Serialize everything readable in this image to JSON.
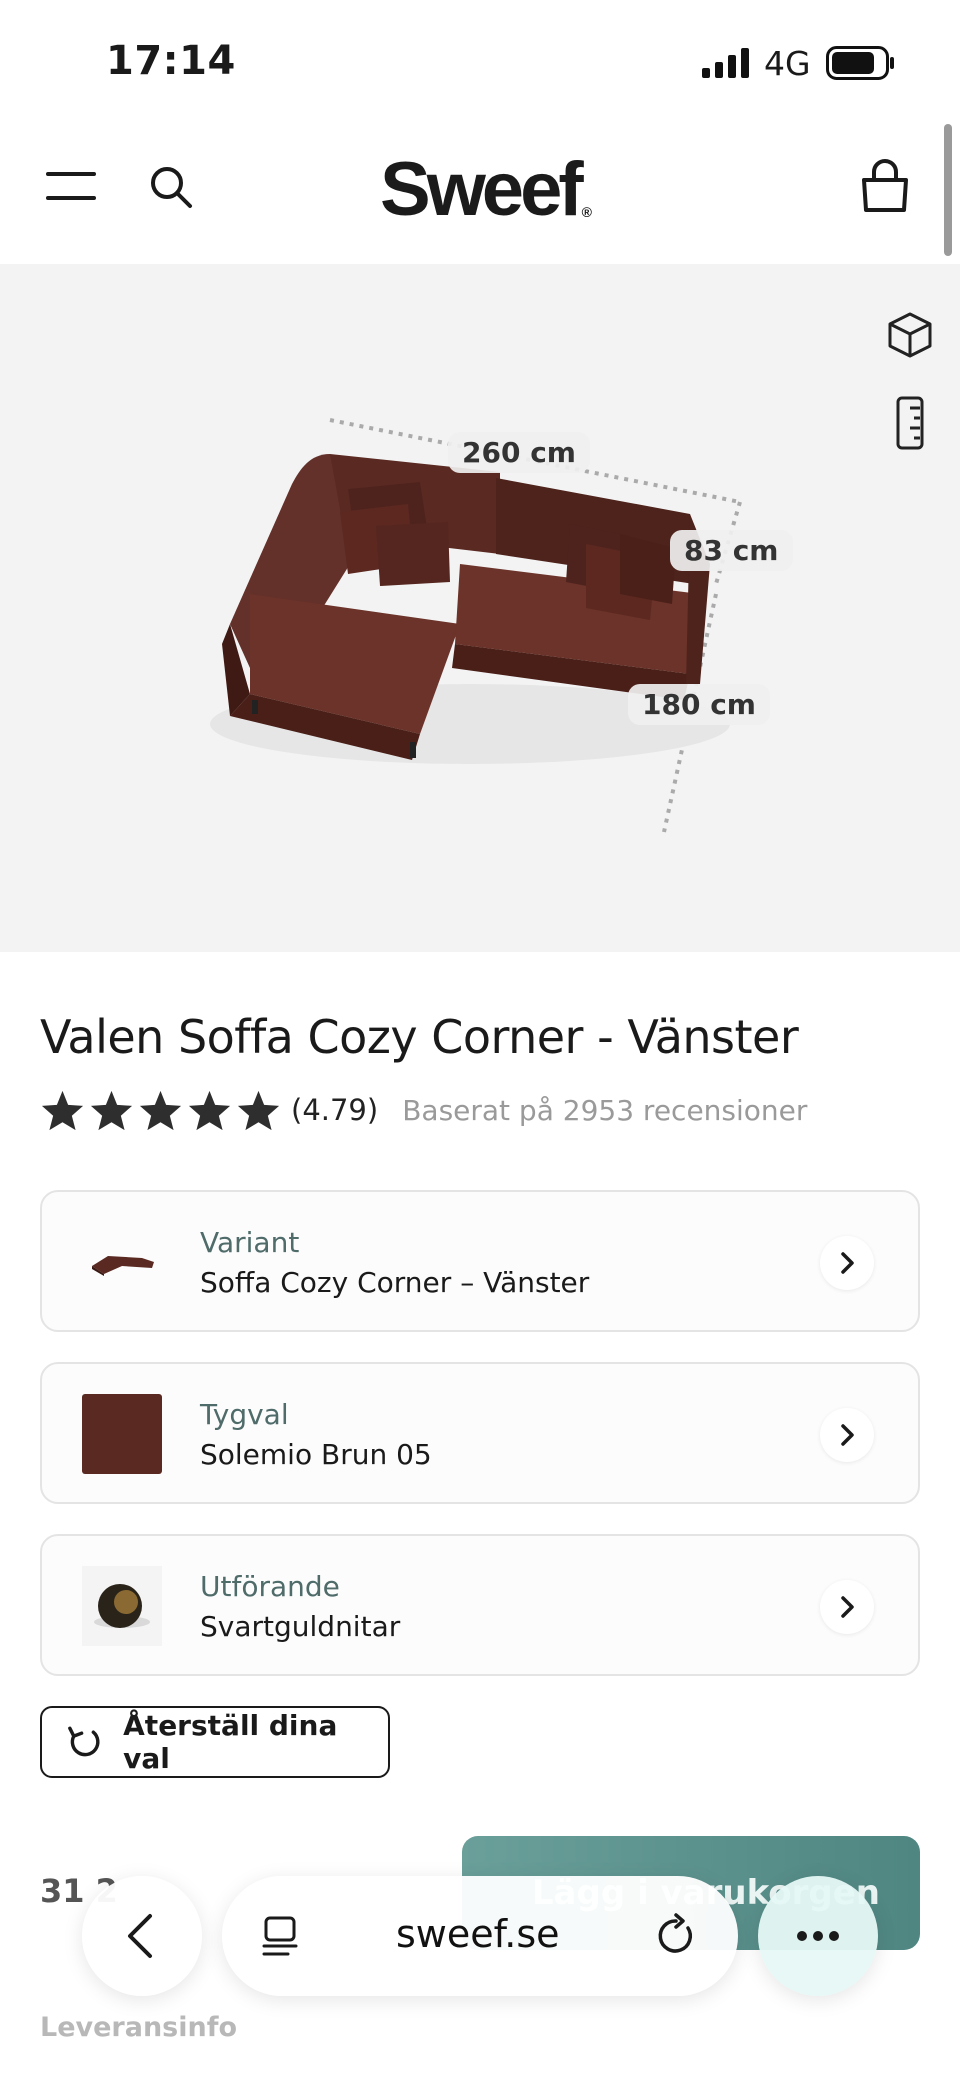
{
  "status": {
    "time": "17:14",
    "network": "4G"
  },
  "header": {
    "logo": "Sweef",
    "logo_mark": "®"
  },
  "hero": {
    "dimensions": {
      "width": "260 cm",
      "height": "83 cm",
      "depth": "180 cm"
    },
    "sofa_color": "#5a2a22"
  },
  "product": {
    "title": "Valen Soffa Cozy Corner - Vänster",
    "rating": {
      "stars": 4.79,
      "score": "(4.79)",
      "reviews": "Baserat på 2953 recensioner"
    },
    "options": [
      {
        "label": "Variant",
        "value": "Soffa Cozy Corner – Vänster"
      },
      {
        "label": "Tygval",
        "value": "Solemio Brun 05",
        "swatch": "#5a2a22"
      },
      {
        "label": "Utförande",
        "value": "Svartguldnitar"
      }
    ],
    "reset_label": "Återställ dina val",
    "price": "31 2",
    "cart_button": "Lägg i varukorgen",
    "delivery_label": "Leveransinfo"
  },
  "browser": {
    "url": "sweef.se"
  },
  "colors": {
    "accent": "#5e9692",
    "option_label": "#4f6b6a"
  }
}
